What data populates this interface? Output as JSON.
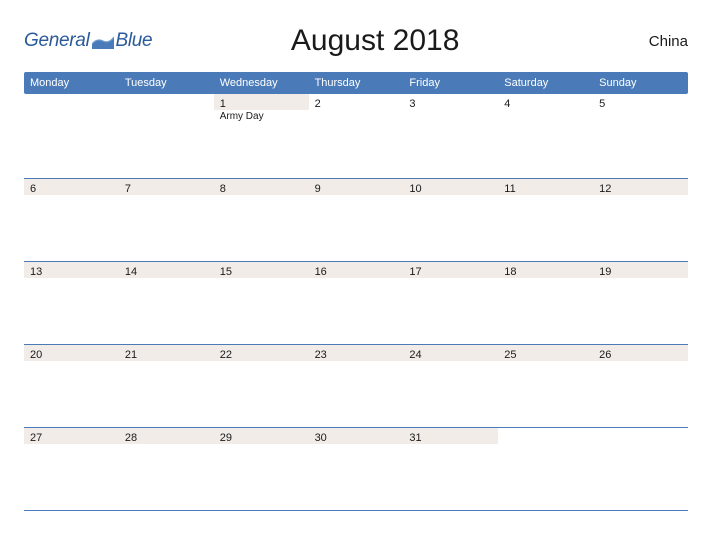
{
  "brand": {
    "name": "General",
    "accent_word": "Blue"
  },
  "title": "August 2018",
  "region": "China",
  "colors": {
    "primary": "#4a7bb8",
    "shade": "#f1ece8"
  },
  "dow": [
    "Monday",
    "Tuesday",
    "Wednesday",
    "Thursday",
    "Friday",
    "Saturday",
    "Sunday"
  ],
  "weeks": [
    [
      {
        "num": "",
        "shaded": false,
        "event": ""
      },
      {
        "num": "",
        "shaded": false,
        "event": ""
      },
      {
        "num": "1",
        "shaded": true,
        "event": "Army Day"
      },
      {
        "num": "2",
        "shaded": false,
        "event": ""
      },
      {
        "num": "3",
        "shaded": false,
        "event": ""
      },
      {
        "num": "4",
        "shaded": false,
        "event": ""
      },
      {
        "num": "5",
        "shaded": false,
        "event": ""
      }
    ],
    [
      {
        "num": "6",
        "shaded": true,
        "event": ""
      },
      {
        "num": "7",
        "shaded": true,
        "event": ""
      },
      {
        "num": "8",
        "shaded": true,
        "event": ""
      },
      {
        "num": "9",
        "shaded": true,
        "event": ""
      },
      {
        "num": "10",
        "shaded": true,
        "event": ""
      },
      {
        "num": "11",
        "shaded": true,
        "event": ""
      },
      {
        "num": "12",
        "shaded": true,
        "event": ""
      }
    ],
    [
      {
        "num": "13",
        "shaded": true,
        "event": ""
      },
      {
        "num": "14",
        "shaded": true,
        "event": ""
      },
      {
        "num": "15",
        "shaded": true,
        "event": ""
      },
      {
        "num": "16",
        "shaded": true,
        "event": ""
      },
      {
        "num": "17",
        "shaded": true,
        "event": ""
      },
      {
        "num": "18",
        "shaded": true,
        "event": ""
      },
      {
        "num": "19",
        "shaded": true,
        "event": ""
      }
    ],
    [
      {
        "num": "20",
        "shaded": true,
        "event": ""
      },
      {
        "num": "21",
        "shaded": true,
        "event": ""
      },
      {
        "num": "22",
        "shaded": true,
        "event": ""
      },
      {
        "num": "23",
        "shaded": true,
        "event": ""
      },
      {
        "num": "24",
        "shaded": true,
        "event": ""
      },
      {
        "num": "25",
        "shaded": true,
        "event": ""
      },
      {
        "num": "26",
        "shaded": true,
        "event": ""
      }
    ],
    [
      {
        "num": "27",
        "shaded": true,
        "event": ""
      },
      {
        "num": "28",
        "shaded": true,
        "event": ""
      },
      {
        "num": "29",
        "shaded": true,
        "event": ""
      },
      {
        "num": "30",
        "shaded": true,
        "event": ""
      },
      {
        "num": "31",
        "shaded": true,
        "event": ""
      },
      {
        "num": "",
        "shaded": false,
        "event": ""
      },
      {
        "num": "",
        "shaded": false,
        "event": ""
      }
    ]
  ]
}
